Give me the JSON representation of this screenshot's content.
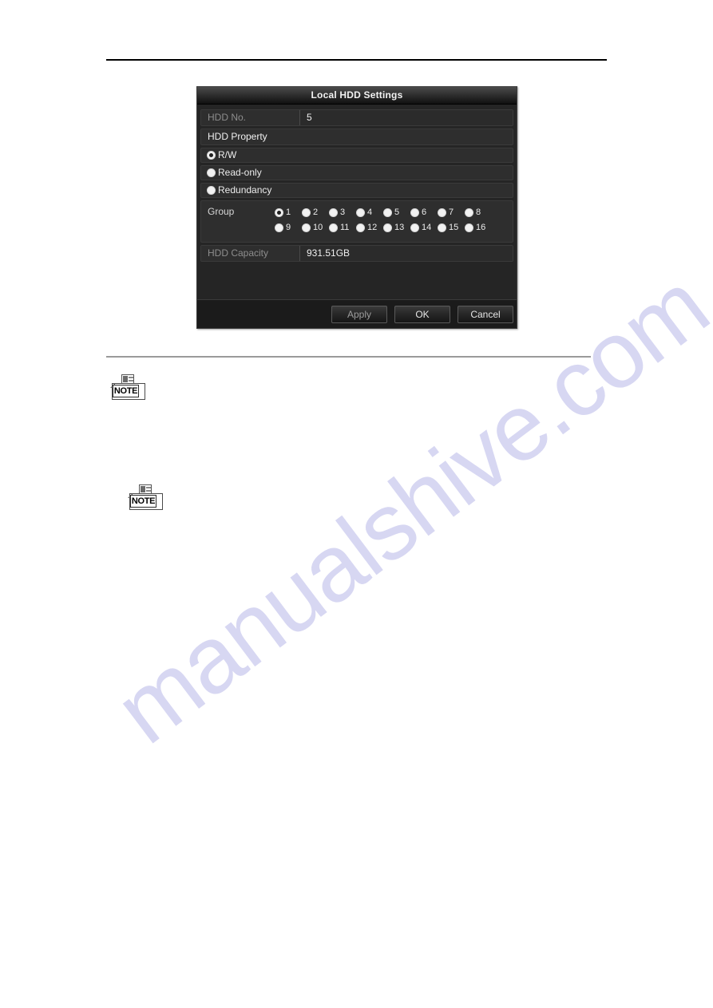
{
  "page": {
    "watermark_text": "manualshive.com",
    "watermark_color": "#d7d7f2"
  },
  "rules": {
    "top_rule": "horizontal-rule-black",
    "bottom_rule": "horizontal-rule-gray"
  },
  "notes": [
    {
      "label": "NOTE"
    },
    {
      "label": "NOTE"
    }
  ],
  "dialog": {
    "title": "Local HDD Settings",
    "hdd_no": {
      "label": "HDD No.",
      "value": "5"
    },
    "hdd_property": {
      "header": "HDD Property",
      "options": [
        {
          "label": "R/W",
          "selected": true
        },
        {
          "label": "Read-only",
          "selected": false
        },
        {
          "label": "Redundancy",
          "selected": false
        }
      ]
    },
    "group": {
      "label": "Group",
      "row1": [
        {
          "num": "1",
          "selected": true
        },
        {
          "num": "2",
          "selected": false
        },
        {
          "num": "3",
          "selected": false
        },
        {
          "num": "4",
          "selected": false
        },
        {
          "num": "5",
          "selected": false
        },
        {
          "num": "6",
          "selected": false
        },
        {
          "num": "7",
          "selected": false
        },
        {
          "num": "8",
          "selected": false
        }
      ],
      "row2": [
        {
          "num": "9",
          "selected": false
        },
        {
          "num": "10",
          "selected": false
        },
        {
          "num": "11",
          "selected": false
        },
        {
          "num": "12",
          "selected": false
        },
        {
          "num": "13",
          "selected": false
        },
        {
          "num": "14",
          "selected": false
        },
        {
          "num": "15",
          "selected": false
        },
        {
          "num": "16",
          "selected": false
        }
      ]
    },
    "hdd_capacity": {
      "label": "HDD Capacity",
      "value": "931.51GB"
    },
    "buttons": {
      "apply": "Apply",
      "ok": "OK",
      "cancel": "Cancel"
    }
  }
}
